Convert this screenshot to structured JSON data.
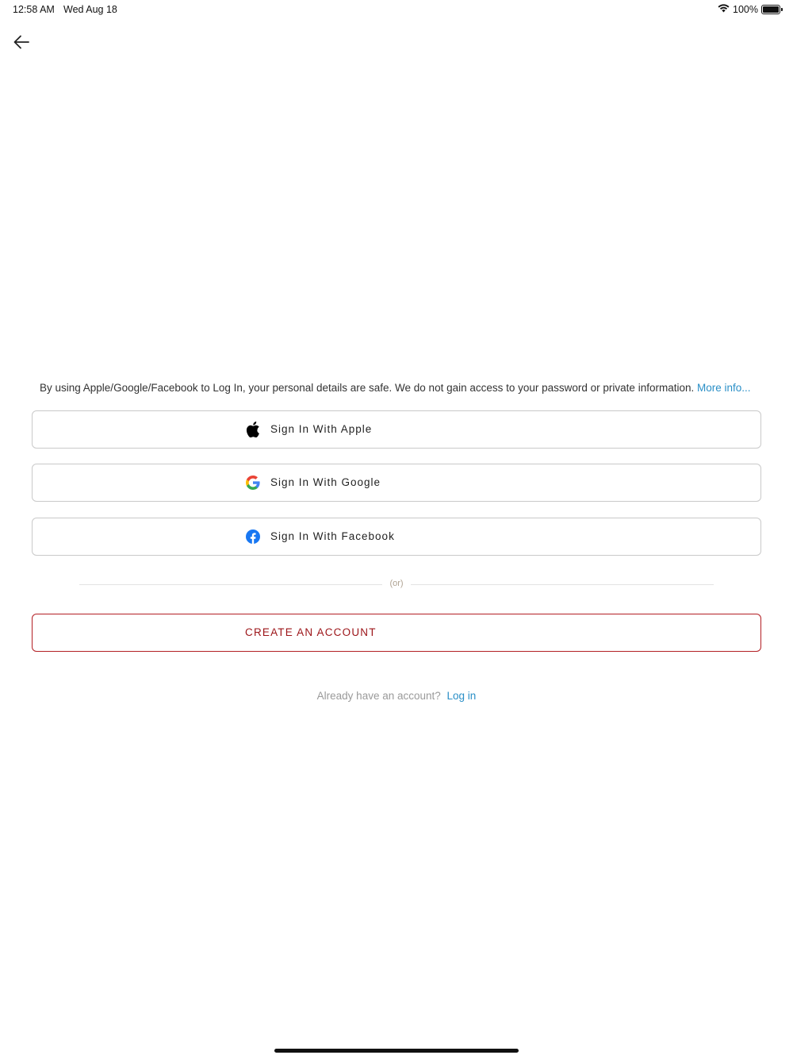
{
  "status_bar": {
    "time": "12:58 AM",
    "date": "Wed Aug 18",
    "battery": "100%",
    "battery_level": 1.0,
    "icons": [
      "wifi-icon",
      "battery-icon"
    ]
  },
  "nav": {
    "back_icon": "arrow-left-icon"
  },
  "disclaimer": {
    "text": "By using Apple/Google/Facebook to Log In, your personal details are safe. We do not gain access to your password or private information.",
    "link": "More info..."
  },
  "social_buttons": [
    {
      "label": "Sign In With Apple",
      "icon": "apple-icon"
    },
    {
      "label": "Sign In With Google",
      "icon": "google-icon"
    },
    {
      "label": "Sign In With Facebook",
      "icon": "facebook-icon"
    }
  ],
  "divider": {
    "text": "(or)"
  },
  "create_account": {
    "label": "CREATE AN ACCOUNT"
  },
  "login": {
    "prompt": "Already have an account?",
    "link": "Log in"
  },
  "colors": {
    "link": "#2a8fc7",
    "brand_red": "#9c1418",
    "facebook_blue": "#1877f2"
  }
}
